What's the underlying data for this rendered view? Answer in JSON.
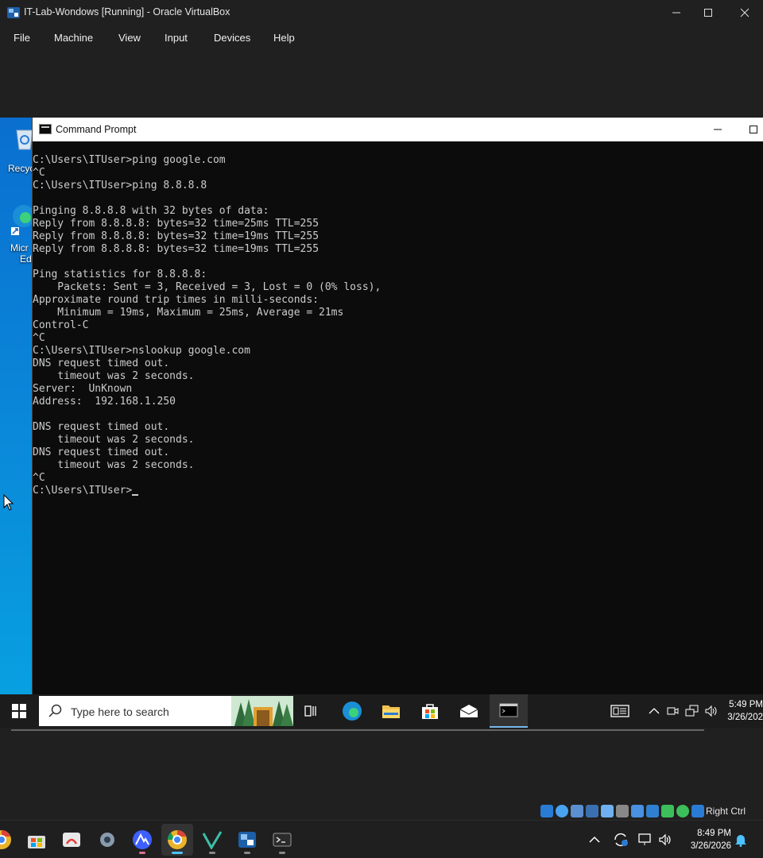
{
  "vbox": {
    "title": "IT-Lab-Wondows [Running] - Oracle VirtualBox",
    "menu": [
      "File",
      "Machine",
      "View",
      "Input",
      "Devices",
      "Help"
    ],
    "status_right": "Right Ctrl"
  },
  "desktop": {
    "icons": [
      {
        "label_line1": "Recyc",
        "icon": "recycle-bin-icon"
      },
      {
        "label_line1": "Micr",
        "label_line2": "Ed",
        "icon": "edge-shortcut-icon"
      }
    ]
  },
  "cmd": {
    "title": "Command Prompt",
    "lines": [
      "C:\\Users\\ITUser>ping google.com",
      "^C",
      "C:\\Users\\ITUser>ping 8.8.8.8",
      "",
      "Pinging 8.8.8.8 with 32 bytes of data:",
      "Reply from 8.8.8.8: bytes=32 time=25ms TTL=255",
      "Reply from 8.8.8.8: bytes=32 time=19ms TTL=255",
      "Reply from 8.8.8.8: bytes=32 time=19ms TTL=255",
      "",
      "Ping statistics for 8.8.8.8:",
      "    Packets: Sent = 3, Received = 3, Lost = 0 (0% loss),",
      "Approximate round trip times in milli-seconds:",
      "    Minimum = 19ms, Maximum = 25ms, Average = 21ms",
      "Control-C",
      "^C",
      "C:\\Users\\ITUser>nslookup google.com",
      "DNS request timed out.",
      "    timeout was 2 seconds.",
      "Server:  UnKnown",
      "Address:  192.168.1.250",
      "",
      "DNS request timed out.",
      "    timeout was 2 seconds.",
      "DNS request timed out.",
      "    timeout was 2 seconds.",
      "^C"
    ],
    "prompt": "C:\\Users\\ITUser>"
  },
  "guest_taskbar": {
    "search_placeholder": "Type here to search",
    "time": "5:49 PM",
    "date": "3/26/202"
  },
  "host_taskbar": {
    "time": "8:49 PM",
    "date": "3/26/2026"
  },
  "colors": {
    "console_bg": "#0c0c0c",
    "console_fg": "#cccccc",
    "accent": "#4cc2ff"
  }
}
